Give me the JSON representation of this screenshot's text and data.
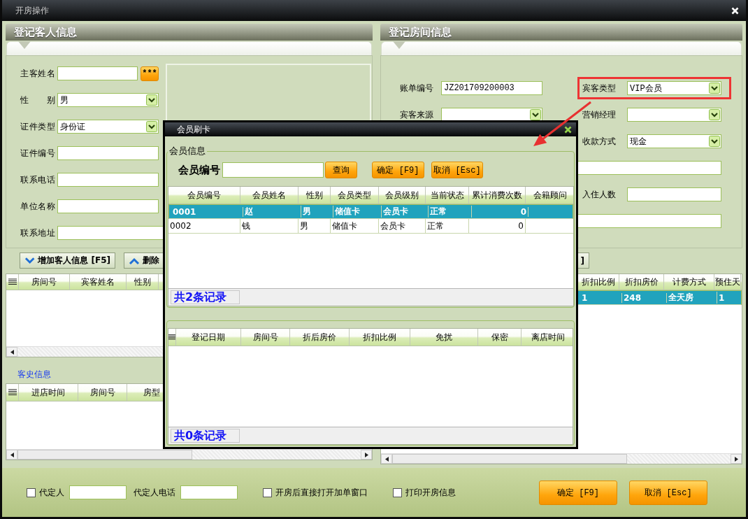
{
  "window": {
    "title": "开房操作"
  },
  "guest_panel": {
    "title": "登记客人信息",
    "fields": [
      {
        "label": "主客姓名",
        "kind": "text",
        "button": "***"
      },
      {
        "label": "性别",
        "kind": "select",
        "value": "男"
      },
      {
        "label": "证件类型",
        "kind": "select",
        "value": "身份证"
      },
      {
        "label": "证件编号",
        "kind": "text"
      },
      {
        "label": "联系电话",
        "kind": "text"
      },
      {
        "label": "单位名称",
        "kind": "text"
      },
      {
        "label": "联系地址",
        "kind": "text"
      }
    ],
    "actions": [
      {
        "label": "增加客人信息 [F5]"
      },
      {
        "label": "删除"
      }
    ],
    "guest_table": {
      "columns": [
        "房间号",
        "宾客姓名",
        "性别"
      ]
    },
    "history_title": "客史信息",
    "history_table": {
      "columns": [
        "进店时间",
        "房间号",
        "房型"
      ]
    }
  },
  "room_panel": {
    "title": "登记房间信息",
    "rows": [
      {
        "left": {
          "label": "账单编号",
          "kind": "text",
          "value": "JZ201709200003"
        },
        "right": {
          "label": "宾客类型",
          "kind": "select",
          "value": "VIP会员",
          "highlighted": true
        }
      },
      {
        "left": {
          "label": "宾客来源",
          "kind": "select"
        },
        "right": {
          "label": "营销经理",
          "kind": "select"
        }
      },
      {
        "right": {
          "label": "收款方式",
          "kind": "select",
          "value": "现金"
        }
      },
      {
        "wide": {
          "kind": "text"
        }
      },
      {
        "right": {
          "label": "入住人数",
          "kind": "text"
        }
      },
      {
        "wide": {
          "kind": "text"
        }
      }
    ],
    "actions": [
      {
        "label": "]"
      }
    ],
    "room_table": {
      "columns": [
        "折扣比例",
        "折扣房价",
        "计费方式",
        "预住天"
      ],
      "rows": [
        {
          "cells": [
            "1",
            "248",
            "全天房",
            "1"
          ],
          "selected": true
        }
      ]
    }
  },
  "member_dialog": {
    "title": "会员刷卡",
    "group_title": "会员信息",
    "search_label": "会员编号",
    "buttons": [
      "查询",
      "确定 [F9]",
      "取消 [Esc]"
    ],
    "member_table": {
      "columns": [
        "会员编号",
        "会员姓名",
        "性别",
        "会员类型",
        "会员级别",
        "当前状态",
        "累计消费次数",
        "会籍顾问"
      ],
      "rows": [
        {
          "cells": [
            "0001",
            "赵",
            "男",
            "储值卡",
            "会员卡",
            "正常",
            "0"
          ],
          "selected": true
        },
        {
          "cells": [
            "0002",
            "钱",
            "男",
            "储值卡",
            "会员卡",
            "正常",
            "0"
          ],
          "selected": false
        }
      ],
      "footer": "共2条记录"
    },
    "history_table": {
      "columns": [
        "登记日期",
        "房间号",
        "折后房价",
        "折扣比例",
        "免扰",
        "保密",
        "离店时间"
      ],
      "footer": "共0条记录"
    }
  },
  "bottom_bar": {
    "items": [
      {
        "kind": "checkbox",
        "label": "代定人",
        "checked": false
      },
      {
        "kind": "field"
      },
      {
        "kind": "label",
        "text": "代定人电话"
      },
      {
        "kind": "field"
      },
      {
        "kind": "checkbox",
        "label": "开房后直接打开加单窗口",
        "checked": false
      },
      {
        "kind": "checkbox",
        "label": "打印开房信息",
        "checked": false
      }
    ],
    "buttons": [
      "确定 [F9]",
      "取消 [Esc]"
    ]
  }
}
